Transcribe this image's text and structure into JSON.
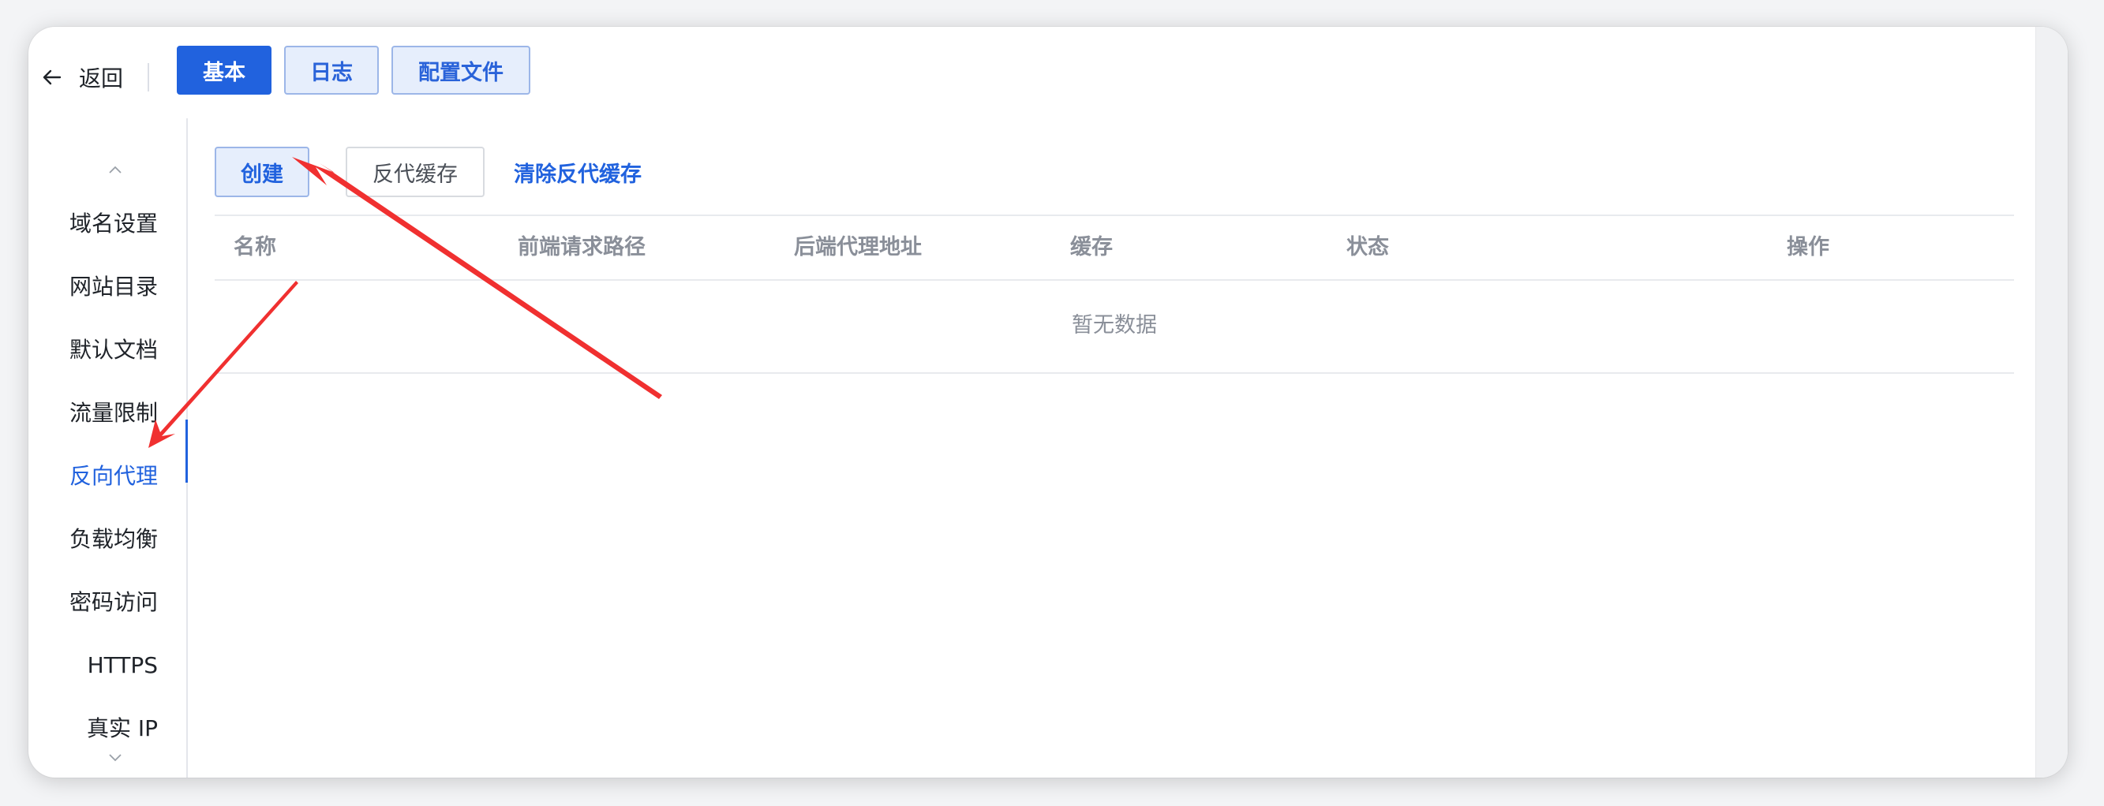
{
  "topbar": {
    "back_label": "返回",
    "tabs": [
      {
        "label": "基本",
        "active": true
      },
      {
        "label": "日志",
        "active": false
      },
      {
        "label": "配置文件",
        "active": false
      }
    ]
  },
  "sidebar": {
    "items": [
      {
        "label": "域名设置"
      },
      {
        "label": "网站目录"
      },
      {
        "label": "默认文档"
      },
      {
        "label": "流量限制"
      },
      {
        "label": "反向代理",
        "active": true
      },
      {
        "label": "负载均衡"
      },
      {
        "label": "密码访问"
      },
      {
        "label": "HTTPS"
      },
      {
        "label": "真实 IP"
      }
    ]
  },
  "toolbar": {
    "create_label": "创建",
    "cache_label": "反代缓存",
    "clear_label": "清除反代缓存"
  },
  "table": {
    "columns": [
      "名称",
      "前端请求路径",
      "后端代理地址",
      "缓存",
      "状态",
      "操作"
    ],
    "empty_text": "暂无数据"
  },
  "annotation": {
    "arrow_color": "#f03030"
  },
  "colors": {
    "accent": "#2162de",
    "muted_text": "#8a8f99"
  }
}
